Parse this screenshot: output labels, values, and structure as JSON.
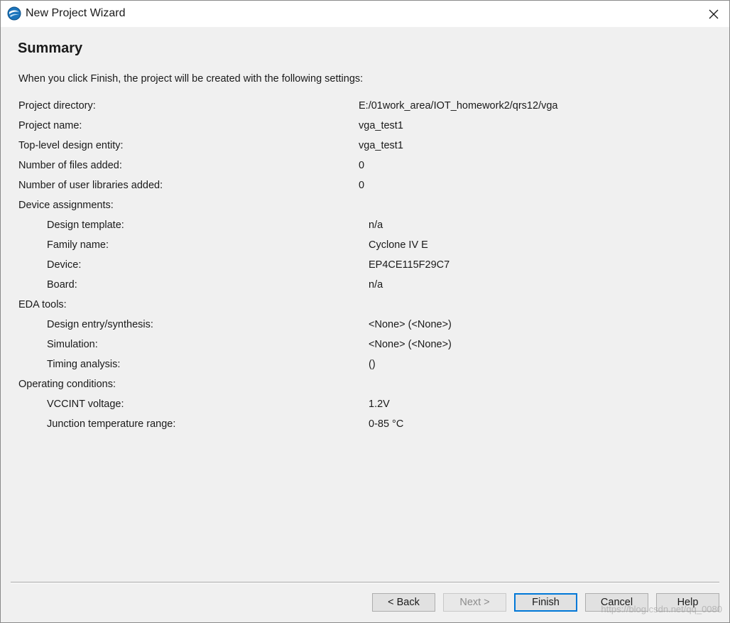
{
  "window": {
    "title": "New Project Wizard",
    "close_icon": "close-icon",
    "app_icon": "quartus-logo-icon"
  },
  "page": {
    "heading": "Summary",
    "intro": "When you click Finish, the project will be created with the following settings:"
  },
  "settings": [
    {
      "label": "Project directory:",
      "value": "E:/01work_area/IOT_homework2/qrs12/vga",
      "indent": false
    },
    {
      "label": "Project name:",
      "value": "vga_test1",
      "indent": false
    },
    {
      "label": "Top-level design entity:",
      "value": "vga_test1",
      "indent": false
    },
    {
      "label": "Number of files added:",
      "value": "0",
      "indent": false
    },
    {
      "label": "Number of user libraries added:",
      "value": "0",
      "indent": false
    },
    {
      "label": "Device assignments:",
      "value": "",
      "indent": false
    },
    {
      "label": "Design template:",
      "value": "n/a",
      "indent": true
    },
    {
      "label": "Family name:",
      "value": "Cyclone IV E",
      "indent": true
    },
    {
      "label": "Device:",
      "value": "EP4CE115F29C7",
      "indent": true
    },
    {
      "label": "Board:",
      "value": "n/a",
      "indent": true
    },
    {
      "label": "EDA tools:",
      "value": "",
      "indent": false
    },
    {
      "label": "Design entry/synthesis:",
      "value": "<None> (<None>)",
      "indent": true
    },
    {
      "label": "Simulation:",
      "value": "<None> (<None>)",
      "indent": true
    },
    {
      "label": "Timing analysis:",
      "value": " ()",
      "indent": true
    },
    {
      "label": "Operating conditions:",
      "value": "",
      "indent": false
    },
    {
      "label": "VCCINT voltage:",
      "value": "1.2V",
      "indent": true
    },
    {
      "label": "Junction temperature range:",
      "value": "0-85 °C",
      "indent": true
    }
  ],
  "buttons": {
    "back": "< Back",
    "next": "Next >",
    "finish": "Finish",
    "cancel": "Cancel",
    "help": "Help"
  },
  "watermark": "https://blog.csdn.net/qq_0080"
}
